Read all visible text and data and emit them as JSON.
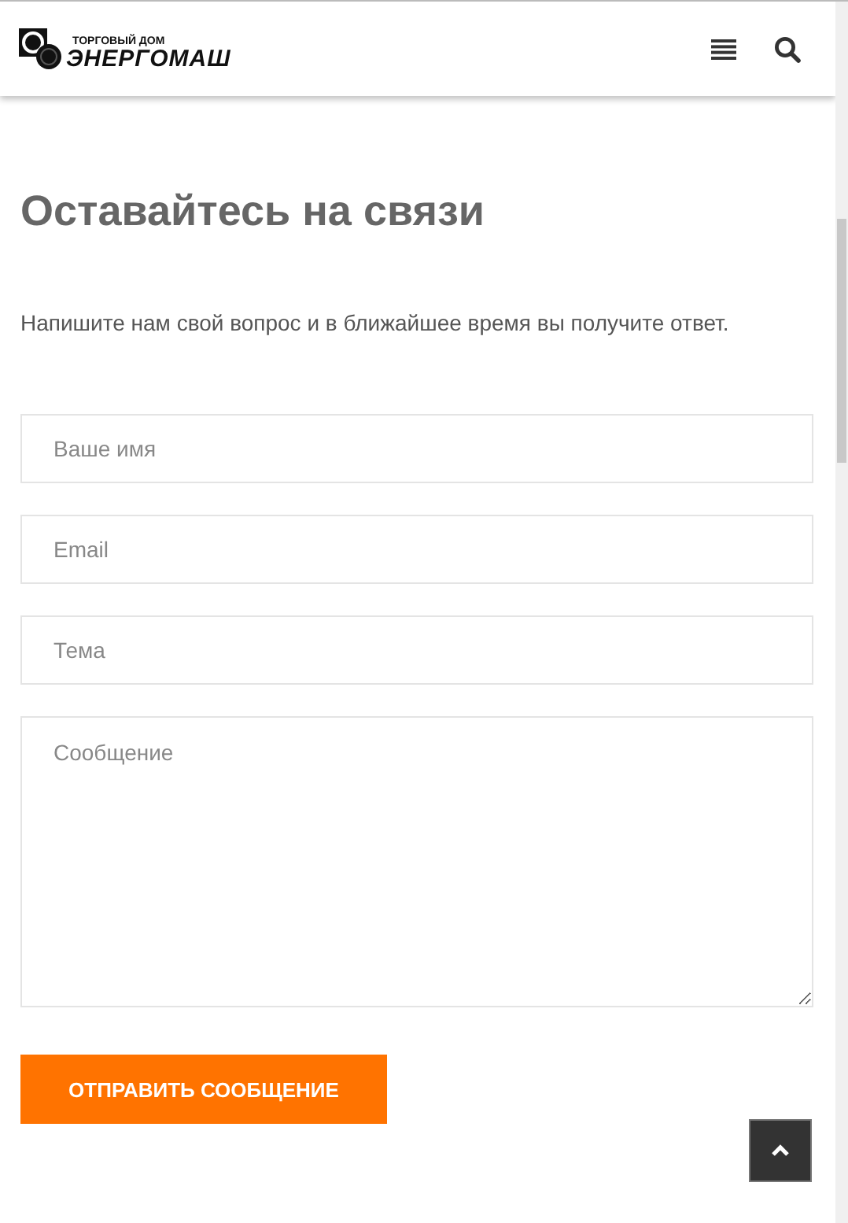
{
  "header": {
    "logo": {
      "small": "ТОРГОВЫЙ ДОМ",
      "name": "ЭНЕРГОМАШ"
    }
  },
  "title": "Оставайтесь на связи",
  "intro": "Напишите нам свой вопрос и в ближайшее время вы получите ответ.",
  "fields": [
    {
      "kind": "input",
      "placeholder": "Ваше имя"
    },
    {
      "kind": "input",
      "placeholder": "Email"
    },
    {
      "kind": "input",
      "placeholder": "Тема"
    },
    {
      "kind": "textarea",
      "placeholder": "Сообщение"
    }
  ],
  "submit": "ОТПРАВИТЬ СООБЩЕНИЕ"
}
